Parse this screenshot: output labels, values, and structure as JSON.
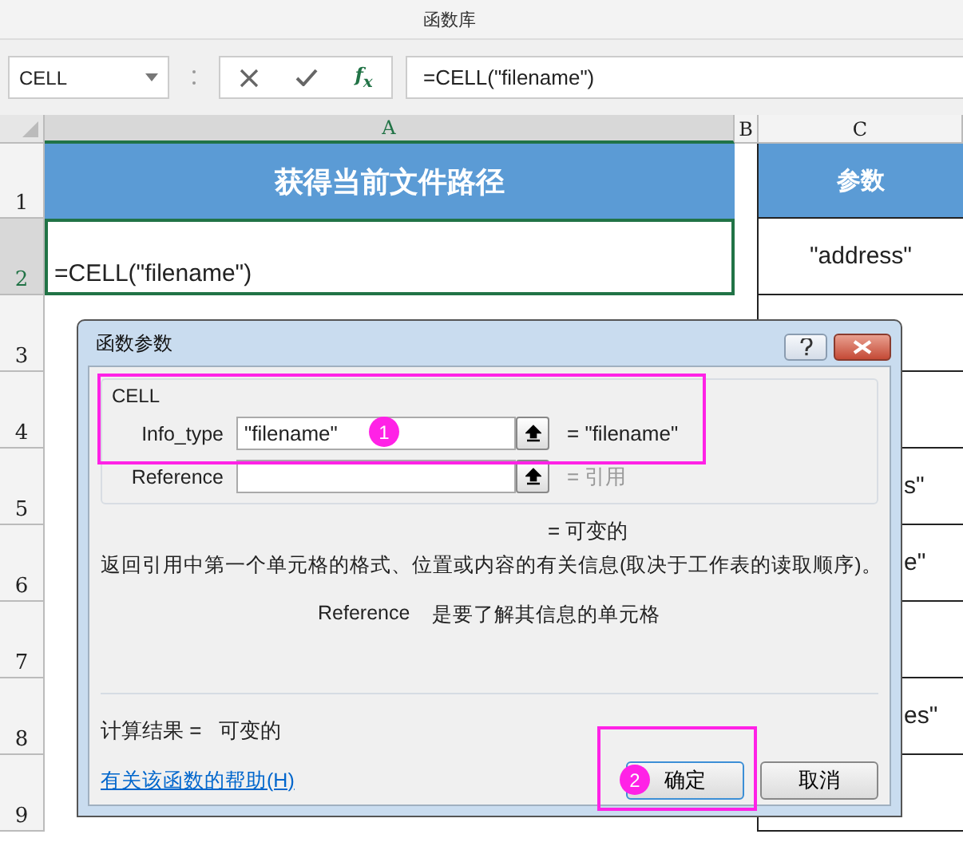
{
  "ribbon": {
    "group_label": "函数库"
  },
  "formula_bar": {
    "name_box": "CELL",
    "fx": "f$_{x}$",
    "formula": "=CELL(\"filename\")"
  },
  "sheet": {
    "columns": [
      {
        "label": "A",
        "selected": true
      },
      {
        "label": "B",
        "selected": false
      },
      {
        "label": "C",
        "selected": false
      }
    ],
    "rows": [
      {
        "number": "1",
        "selected": false,
        "kind": "heading",
        "a": "获得当前文件路径",
        "c": "参数"
      },
      {
        "number": "2",
        "selected": true,
        "kind": "data",
        "a": "=CELL(\"filename\")",
        "c": "\"address\""
      },
      {
        "number": "3",
        "selected": false,
        "kind": "data"
      },
      {
        "number": "4",
        "selected": false,
        "kind": "data"
      },
      {
        "number": "5",
        "selected": false,
        "kind": "data",
        "c": "s\""
      },
      {
        "number": "6",
        "selected": false,
        "kind": "data",
        "c": "e\""
      },
      {
        "number": "7",
        "selected": false,
        "kind": "data"
      },
      {
        "number": "8",
        "selected": false,
        "kind": "data",
        "c": "es\""
      },
      {
        "number": "9",
        "selected": false,
        "kind": "data"
      }
    ]
  },
  "dialog": {
    "title": "函数参数",
    "function_name": "CELL",
    "arguments": [
      {
        "name": "Info_type",
        "value": "\"filename\"",
        "result": "= \"filename\"",
        "result_hint": false
      },
      {
        "name": "Reference",
        "result": "= 引用",
        "result_hint": true
      }
    ],
    "function_result": "= 可变的",
    "description": "返回引用中第一个单元格的格式、位置或内容的有关信息(取决于工作表的读取顺序)。",
    "argument_help": {
      "name": "Reference",
      "text": "是要了解其信息的单元格"
    },
    "calc_result": "计算结果 =   可变的",
    "help_link": "有关该函数的帮助(H)",
    "buttons": [
      "确定",
      "取消"
    ]
  },
  "annotations": [
    {
      "label": "1"
    },
    {
      "label": "2"
    }
  ]
}
